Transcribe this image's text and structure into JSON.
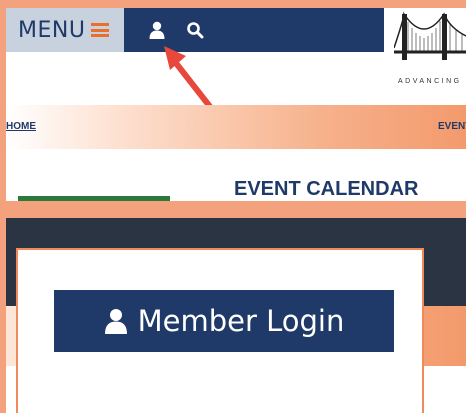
{
  "nav": {
    "menu_label": "MENU",
    "accent_color": "#e96f2a",
    "bar_color": "#1f3a68",
    "user_icon": "user-icon",
    "search_icon": "search-icon"
  },
  "logo": {
    "tagline": "ADVANCING"
  },
  "breadcrumb": {
    "home": "HOME",
    "current": "EVENT"
  },
  "main": {
    "title": "EVENT CALENDAR"
  },
  "login": {
    "button_label": "Member Login",
    "icon": "user-icon"
  },
  "annotation": {
    "arrow_color": "#e8473b"
  }
}
